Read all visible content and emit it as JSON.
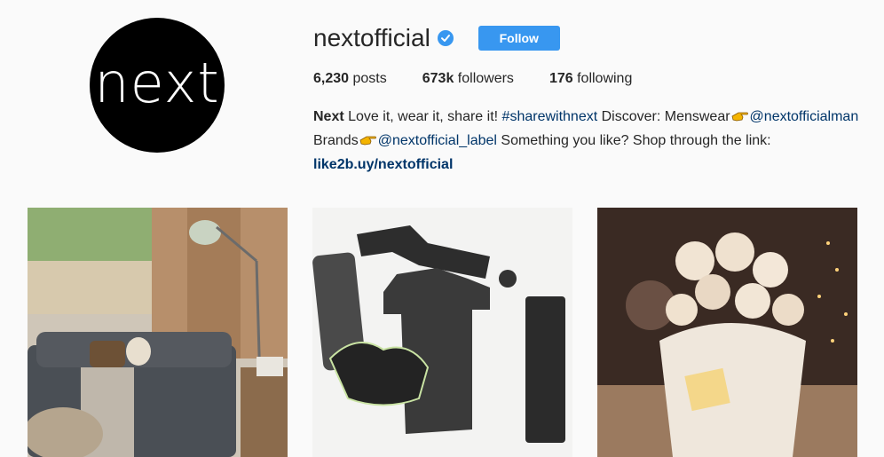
{
  "profile": {
    "avatar_text": "next",
    "username": "nextofficial",
    "follow_label": "Follow",
    "stats": {
      "posts_count": "6,230",
      "posts_label": "posts",
      "followers_count": "673k",
      "followers_label": "followers",
      "following_count": "176",
      "following_label": "following"
    },
    "bio": {
      "name": "Next",
      "text1": " Love it, wear it, share it! ",
      "hashtag": "#sharewithnext",
      "text2": " Discover: Menswear",
      "mention1": "@nextofficialman",
      "text3": "Brands",
      "mention2": "@nextofficial_label",
      "text4": " Something you like? Shop through the link:",
      "link": "like2b.uy/nextofficial"
    }
  },
  "posts_visible": 3,
  "colors": {
    "accent": "#3897f0",
    "background": "#fafafa",
    "link": "#003569"
  },
  "icons": [
    "verified-badge-icon",
    "pointing-hand-icon"
  ]
}
